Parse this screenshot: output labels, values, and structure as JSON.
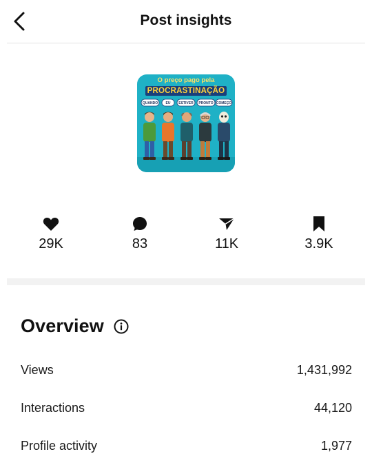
{
  "header": {
    "title": "Post insights",
    "back_icon": "chevron-left-icon"
  },
  "thumbnail": {
    "caption_line1": "O preço pago pela",
    "caption_line2": "PROCRASTINAÇÃO",
    "bubbles": [
      "QUANDO",
      "EU",
      "ESTIVER",
      "PRONTO",
      "COMEÇO"
    ],
    "background_color": "#1fb1c6"
  },
  "stats": [
    {
      "icon": "heart-icon",
      "value": "29K"
    },
    {
      "icon": "comment-icon",
      "value": "83"
    },
    {
      "icon": "share-icon",
      "value": "11K"
    },
    {
      "icon": "bookmark-icon",
      "value": "3.9K"
    }
  ],
  "overview": {
    "title": "Overview",
    "info_icon": "info-icon",
    "rows": [
      {
        "label": "Views",
        "value": "1,431,992"
      },
      {
        "label": "Interactions",
        "value": "44,120"
      },
      {
        "label": "Profile activity",
        "value": "1,977"
      }
    ]
  }
}
